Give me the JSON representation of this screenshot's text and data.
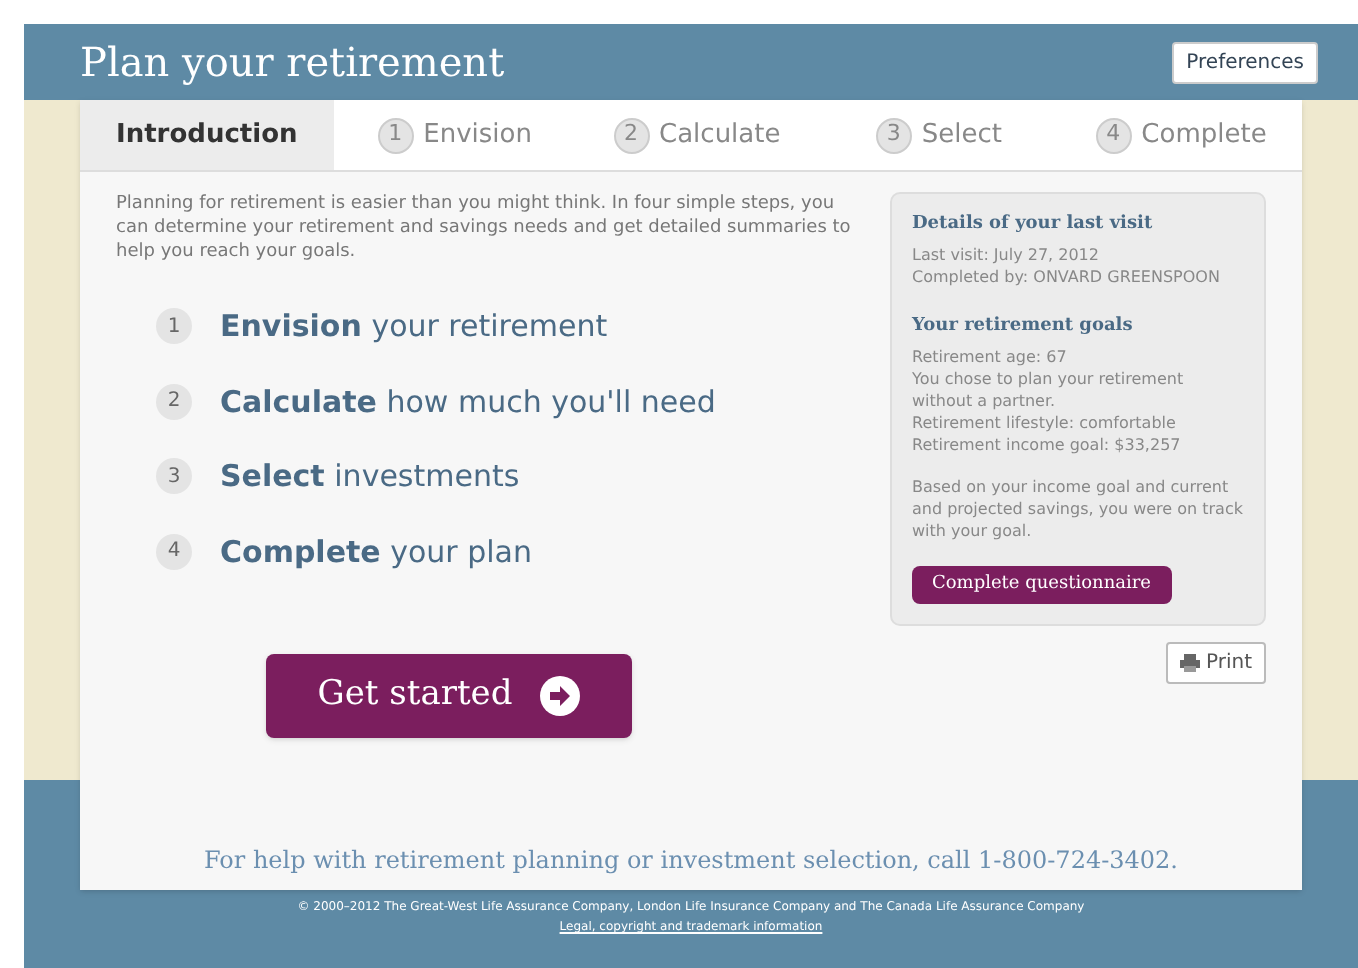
{
  "header": {
    "title": "Plan your retirement",
    "preferences_button": "Preferences"
  },
  "steps": [
    {
      "label": "Introduction",
      "selected": true
    },
    {
      "number": "1",
      "label": "Envision",
      "selected": false
    },
    {
      "number": "2",
      "label": "Calculate",
      "selected": false
    },
    {
      "number": "3",
      "label": "Select",
      "selected": false
    },
    {
      "number": "4",
      "label": "Complete",
      "selected": false
    }
  ],
  "intro": "Planning for retirement is easier than you might think. In four simple steps, you can determine your retirement and savings needs and get detailed summaries to help you reach your goals.",
  "plan_steps": [
    {
      "number": "1",
      "title": "Envision",
      "rest": "your retirement"
    },
    {
      "number": "2",
      "title": "Calculate",
      "rest": "how much you'll need"
    },
    {
      "number": "3",
      "title": "Select",
      "rest": "investments"
    },
    {
      "number": "4",
      "title": "Complete",
      "rest": "your plan"
    }
  ],
  "get_started_button": "Get started",
  "last_visit": {
    "heading": "Details of your last visit",
    "lines": [
      "Last visit: July 27, 2012",
      "Completed by: ONVARD GREENSPOON"
    ]
  },
  "goals": {
    "heading": "Your retirement goals",
    "lines": [
      "Retirement age: 67",
      "You chose to plan your retirement without a partner.",
      "Retirement lifestyle: comfortable",
      "Retirement income goal: $33,257"
    ],
    "summary": "Based on your income goal and current and projected savings, you were on track with your goal."
  },
  "complete_questionnaire_button": "Complete questionnaire",
  "print_button": "Print",
  "help_text": "For help with retirement planning or investment selection, call 1-800-724-3402.",
  "footer": {
    "copyright": "© 2000–2012 The Great-West Life Assurance Company, London Life Insurance Company and The Canada Life Assurance Company",
    "legal_link": "Legal, copyright and trademark information"
  }
}
